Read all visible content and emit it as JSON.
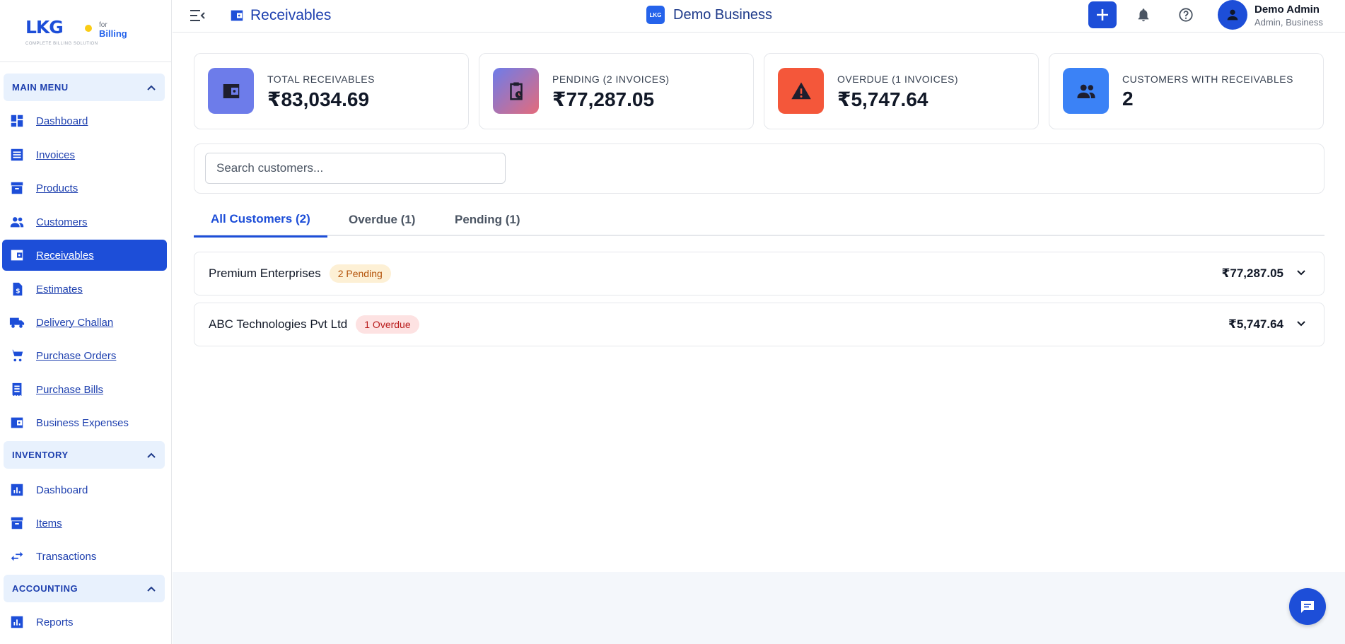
{
  "brand": {
    "mark": "LKG",
    "for": "for",
    "product": "Billing",
    "tagline": "COMPLETE BILLING SOLUTION"
  },
  "sidebar": {
    "sections": [
      {
        "title": "MAIN MENU"
      },
      {
        "title": "INVENTORY"
      },
      {
        "title": "ACCOUNTING"
      }
    ],
    "main_items": [
      {
        "label": "Dashboard"
      },
      {
        "label": "Invoices"
      },
      {
        "label": "Products"
      },
      {
        "label": "Customers"
      },
      {
        "label": "Receivables"
      },
      {
        "label": "Estimates"
      },
      {
        "label": "Delivery Challan"
      },
      {
        "label": "Purchase Orders"
      },
      {
        "label": "Purchase Bills"
      },
      {
        "label": "Business Expenses"
      }
    ],
    "inventory_items": [
      {
        "label": "Dashboard"
      },
      {
        "label": "Items"
      },
      {
        "label": "Transactions"
      }
    ],
    "accounting_items": [
      {
        "label": "Reports"
      }
    ]
  },
  "topbar": {
    "page_title": "Receivables",
    "business_logo": "LKG",
    "business_name": "Demo Business",
    "add_label": "+",
    "user_name": "Demo Admin",
    "user_role": "Admin, Business"
  },
  "cards": [
    {
      "label": "TOTAL RECEIVABLES",
      "value": "₹83,034.69",
      "color": "#6d7cea"
    },
    {
      "label": "PENDING (2 INVOICES)",
      "value": "₹77,287.05",
      "color": "#9b6fc8"
    },
    {
      "label": "OVERDUE (1 INVOICES)",
      "value": "₹5,747.64",
      "color": "#f4573a"
    },
    {
      "label": "CUSTOMERS WITH RECEIVABLES",
      "value": "2",
      "color": "#3b82f6"
    }
  ],
  "search": {
    "placeholder": "Search customers..."
  },
  "tabs": [
    {
      "label": "All Customers (2)"
    },
    {
      "label": "Overdue (1)"
    },
    {
      "label": "Pending (1)"
    }
  ],
  "customers": [
    {
      "name": "Premium Enterprises",
      "badge": "2 Pending",
      "amount": "₹77,287.05"
    },
    {
      "name": "ABC Technologies Pvt Ltd",
      "badge": "1 Overdue",
      "amount": "₹5,747.64"
    }
  ],
  "colors": {
    "primary": "#1d4ed8",
    "pending_badge": "#fdf0d5",
    "overdue_badge": "#fde2e2"
  }
}
